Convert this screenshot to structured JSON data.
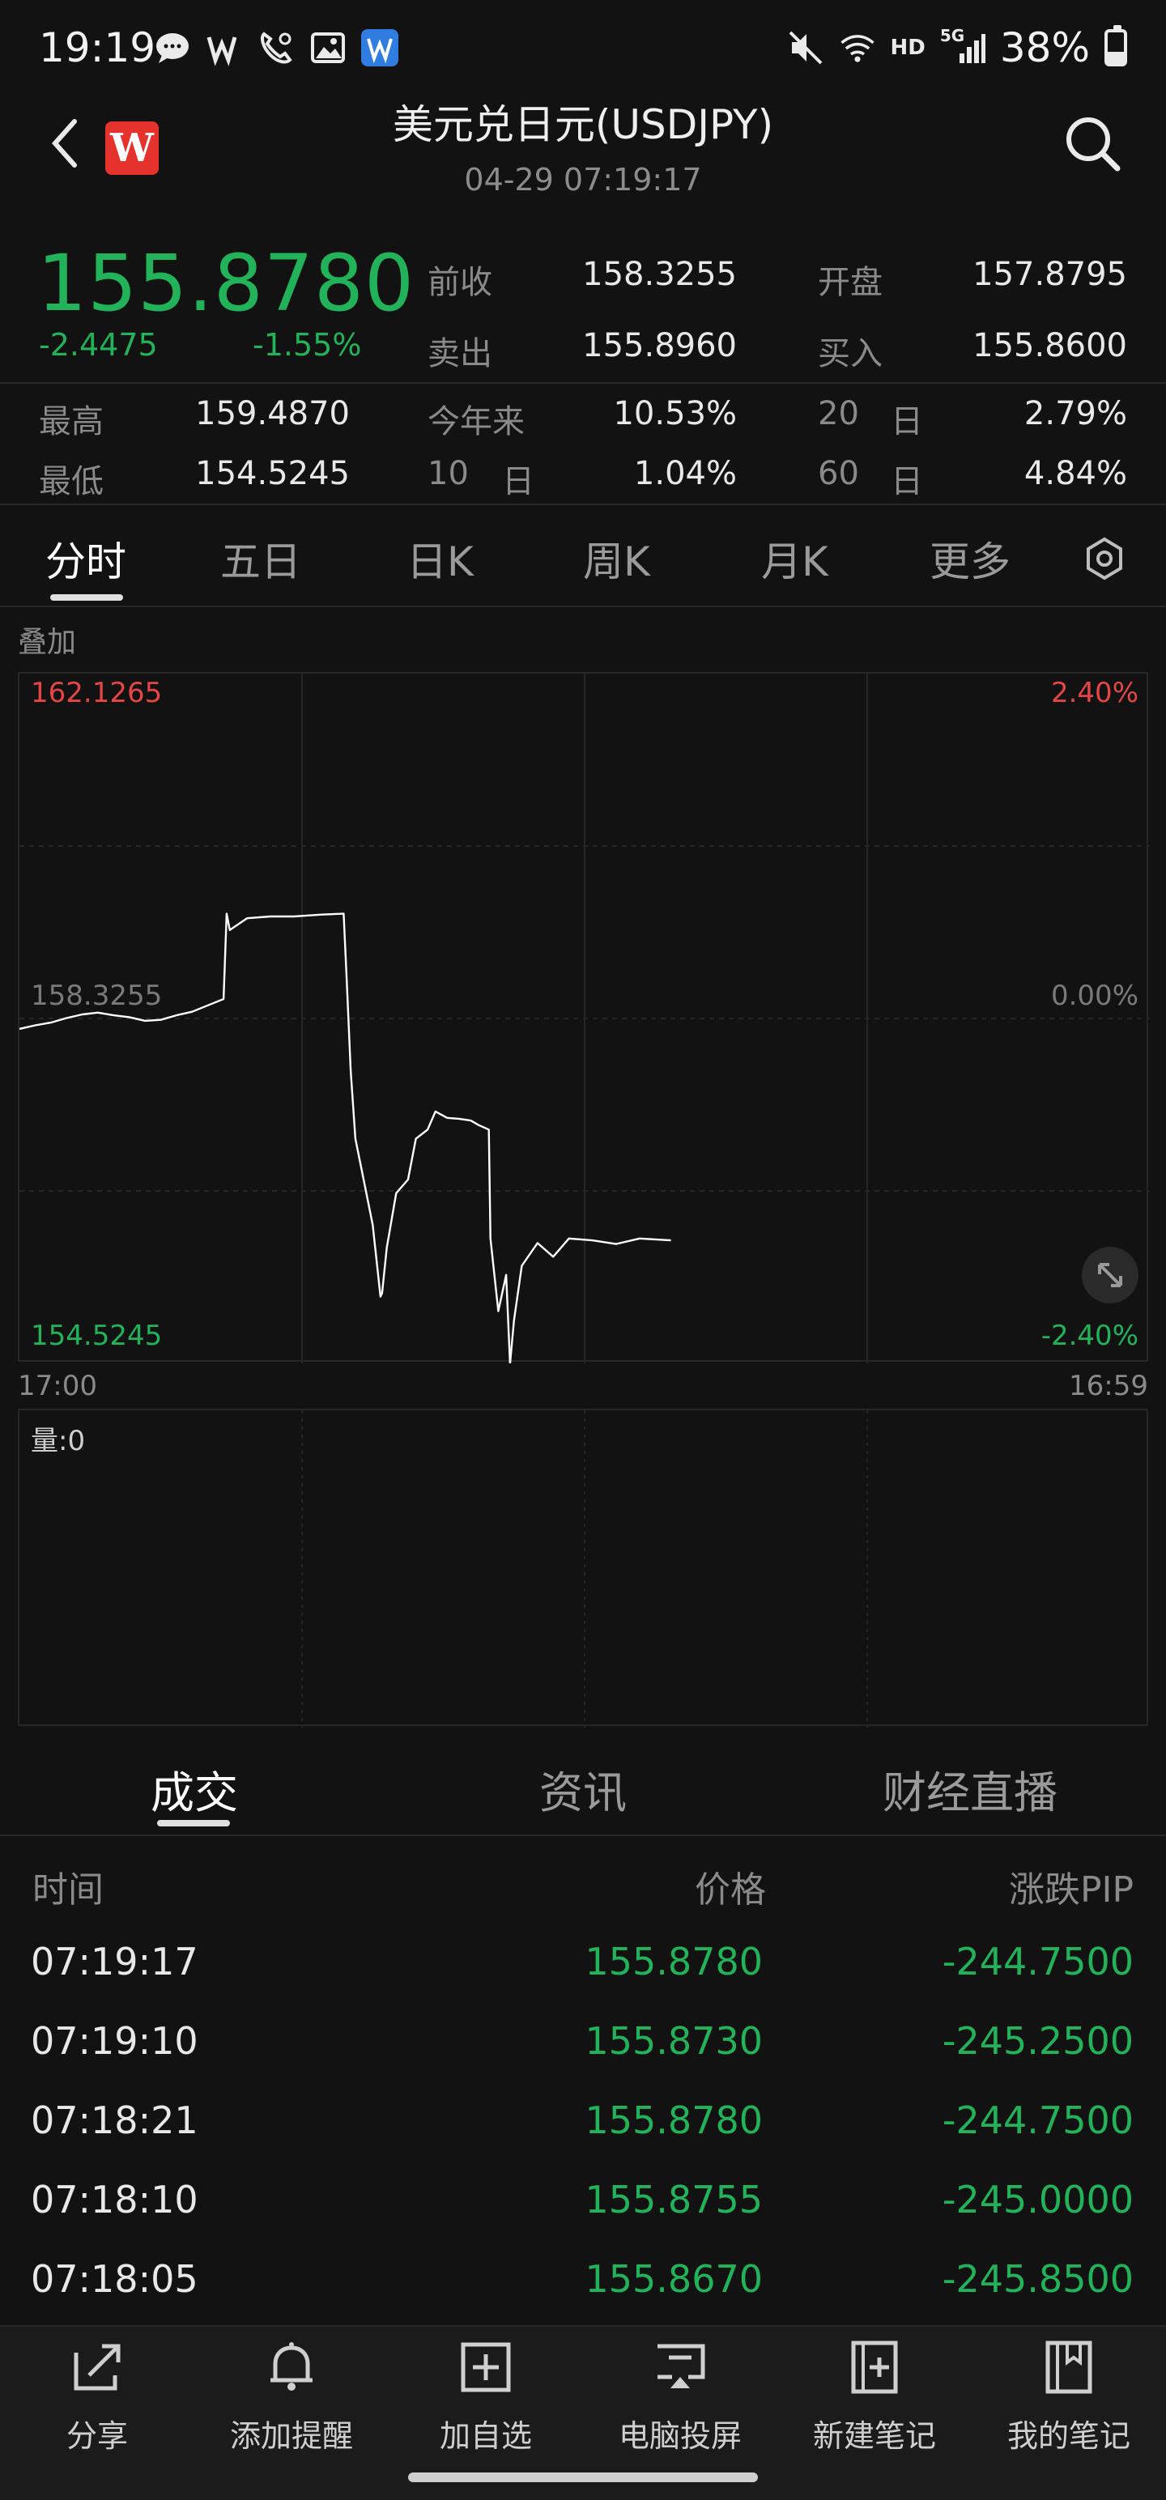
{
  "status_bar": {
    "time": "19:19",
    "network": "HD",
    "network_5g": "5G",
    "battery_text": "38%"
  },
  "header": {
    "title": "美元兑日元(USDJPY)",
    "timestamp": "04-29 07:19:17",
    "logo_letter": "W"
  },
  "quote": {
    "price": "155.8780",
    "change_abs": "-2.4475",
    "change_pct": "-1.55%",
    "fields": {
      "prev_close_label": "前收",
      "prev_close": "158.3255",
      "open_label": "开盘",
      "open": "157.8795",
      "sell_label": "卖出",
      "sell": "155.8960",
      "buy_label": "买入",
      "buy": "155.8600",
      "high_label": "最高",
      "high": "159.4870",
      "low_label": "最低",
      "low": "154.5245",
      "ytd_label": "今年来",
      "ytd": "10.53%",
      "d20_num": "20",
      "d20_unit": "日",
      "d20": "2.79%",
      "d10_num": "10",
      "d10_unit": "日",
      "d10": "1.04%",
      "d60_num": "60",
      "d60_unit": "日",
      "d60": "4.84%"
    }
  },
  "tabs": [
    "分时",
    "五日",
    "日K",
    "周K",
    "月K",
    "更多"
  ],
  "overlay_label": "叠加",
  "chart": {
    "y_top_price": "162.1265",
    "y_mid_price": "158.3255",
    "y_bot_price": "154.5245",
    "y_top_pct": "2.40%",
    "y_mid_pct": "0.00%",
    "y_bot_pct": "-2.40%",
    "x_start": "17:00",
    "x_end": "16:59",
    "volume_label": "量:0",
    "colors": {
      "up": "#e64545",
      "down": "#22b25a",
      "line": "#ffffff"
    }
  },
  "chart_data": {
    "type": "line",
    "ylim": [
      154.5245,
      162.1265
    ],
    "xlim": [
      0,
      1440
    ],
    "series": [
      {
        "x": [
          0,
          20,
          40,
          60,
          80,
          100,
          120,
          140,
          160,
          180,
          200,
          220,
          240,
          260,
          264,
          268,
          290,
          320,
          350,
          385,
          413,
          417,
          422,
          428,
          435,
          450,
          460,
          462,
          468,
          480,
          495,
          505,
          520,
          530,
          545,
          560,
          575,
          585,
          598,
          600,
          610,
          620,
          625,
          630,
          640,
          660,
          680,
          700,
          730,
          760,
          790,
          830
        ],
        "values": [
          158.21,
          158.25,
          158.28,
          158.33,
          158.37,
          158.39,
          158.36,
          158.34,
          158.3,
          158.31,
          158.36,
          158.4,
          158.47,
          158.54,
          159.48,
          159.3,
          159.43,
          159.45,
          159.45,
          159.47,
          159.48,
          158.73,
          157.75,
          157.0,
          156.7,
          156.05,
          155.26,
          155.3,
          155.8,
          156.4,
          156.55,
          157.0,
          157.1,
          157.3,
          157.23,
          157.22,
          157.2,
          157.15,
          157.1,
          155.9,
          155.1,
          155.5,
          154.52,
          155.0,
          155.6,
          155.85,
          155.7,
          155.9,
          155.88,
          155.84,
          155.9,
          155.88
        ]
      }
    ]
  },
  "subtabs": [
    "成交",
    "资讯",
    "财经直播"
  ],
  "trades": {
    "headers": {
      "time": "时间",
      "price": "价格",
      "pip": "涨跌PIP"
    },
    "rows": [
      {
        "time": "07:19:17",
        "price": "155.8780",
        "pip": "-244.7500"
      },
      {
        "time": "07:19:10",
        "price": "155.8730",
        "pip": "-245.2500"
      },
      {
        "time": "07:18:21",
        "price": "155.8780",
        "pip": "-244.7500"
      },
      {
        "time": "07:18:10",
        "price": "155.8755",
        "pip": "-245.0000"
      },
      {
        "time": "07:18:05",
        "price": "155.8670",
        "pip": "-245.8500"
      }
    ]
  },
  "bottom_nav": [
    {
      "label": "分享",
      "icon": "share-icon"
    },
    {
      "label": "添加提醒",
      "icon": "bell-icon"
    },
    {
      "label": "加自选",
      "icon": "add-watchlist-icon"
    },
    {
      "label": "电脑投屏",
      "icon": "cast-screen-icon"
    },
    {
      "label": "新建笔记",
      "icon": "new-note-icon"
    },
    {
      "label": "我的笔记",
      "icon": "my-notes-icon"
    }
  ]
}
